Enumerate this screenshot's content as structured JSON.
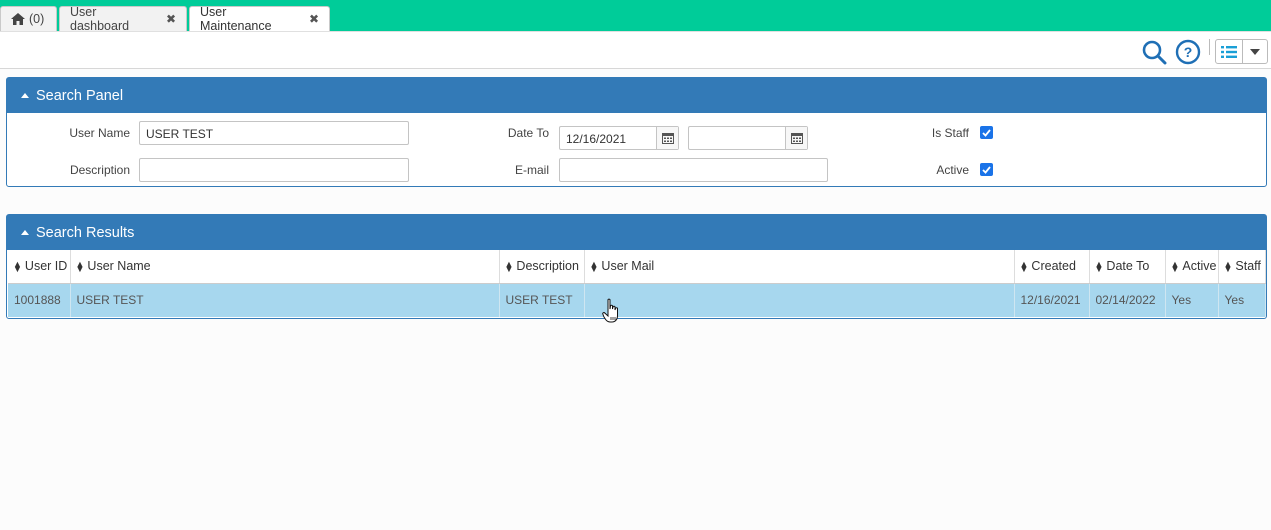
{
  "tabs": [
    {
      "label": "(0)",
      "icon": "home-icon"
    },
    {
      "label": "User dashboard",
      "closable": true
    },
    {
      "label": "User Maintenance",
      "closable": true,
      "active": true
    }
  ],
  "toolbar": {
    "icons": [
      "search-icon",
      "help-icon",
      "list-view-icon",
      "dropdown-caret-icon"
    ]
  },
  "search_panel": {
    "title": "Search Panel",
    "user_name_label": "User Name",
    "user_name_value": "USER TEST",
    "date_to_label": "Date To",
    "date_to_from_value": "12/16/2021",
    "date_to_to_value": "",
    "is_staff_label": "Is Staff",
    "is_staff_checked": true,
    "description_label": "Description",
    "description_value": "",
    "email_label": "E-mail",
    "email_value": "",
    "active_label": "Active",
    "active_checked": true
  },
  "results": {
    "title": "Search Results",
    "columns": [
      "User ID",
      "User Name",
      "Description",
      "User Mail",
      "Created",
      "Date To",
      "Active",
      "Staff"
    ],
    "rows": [
      [
        "1001888",
        "USER TEST",
        "USER TEST",
        "",
        "12/16/2021",
        "02/14/2022",
        "Yes",
        "Yes"
      ]
    ]
  },
  "colors": {
    "tabbar": "#00cc99",
    "panel_header": "#337ab7",
    "row_selected": "#a7d7ee",
    "checkbox": "#1a73e8"
  }
}
